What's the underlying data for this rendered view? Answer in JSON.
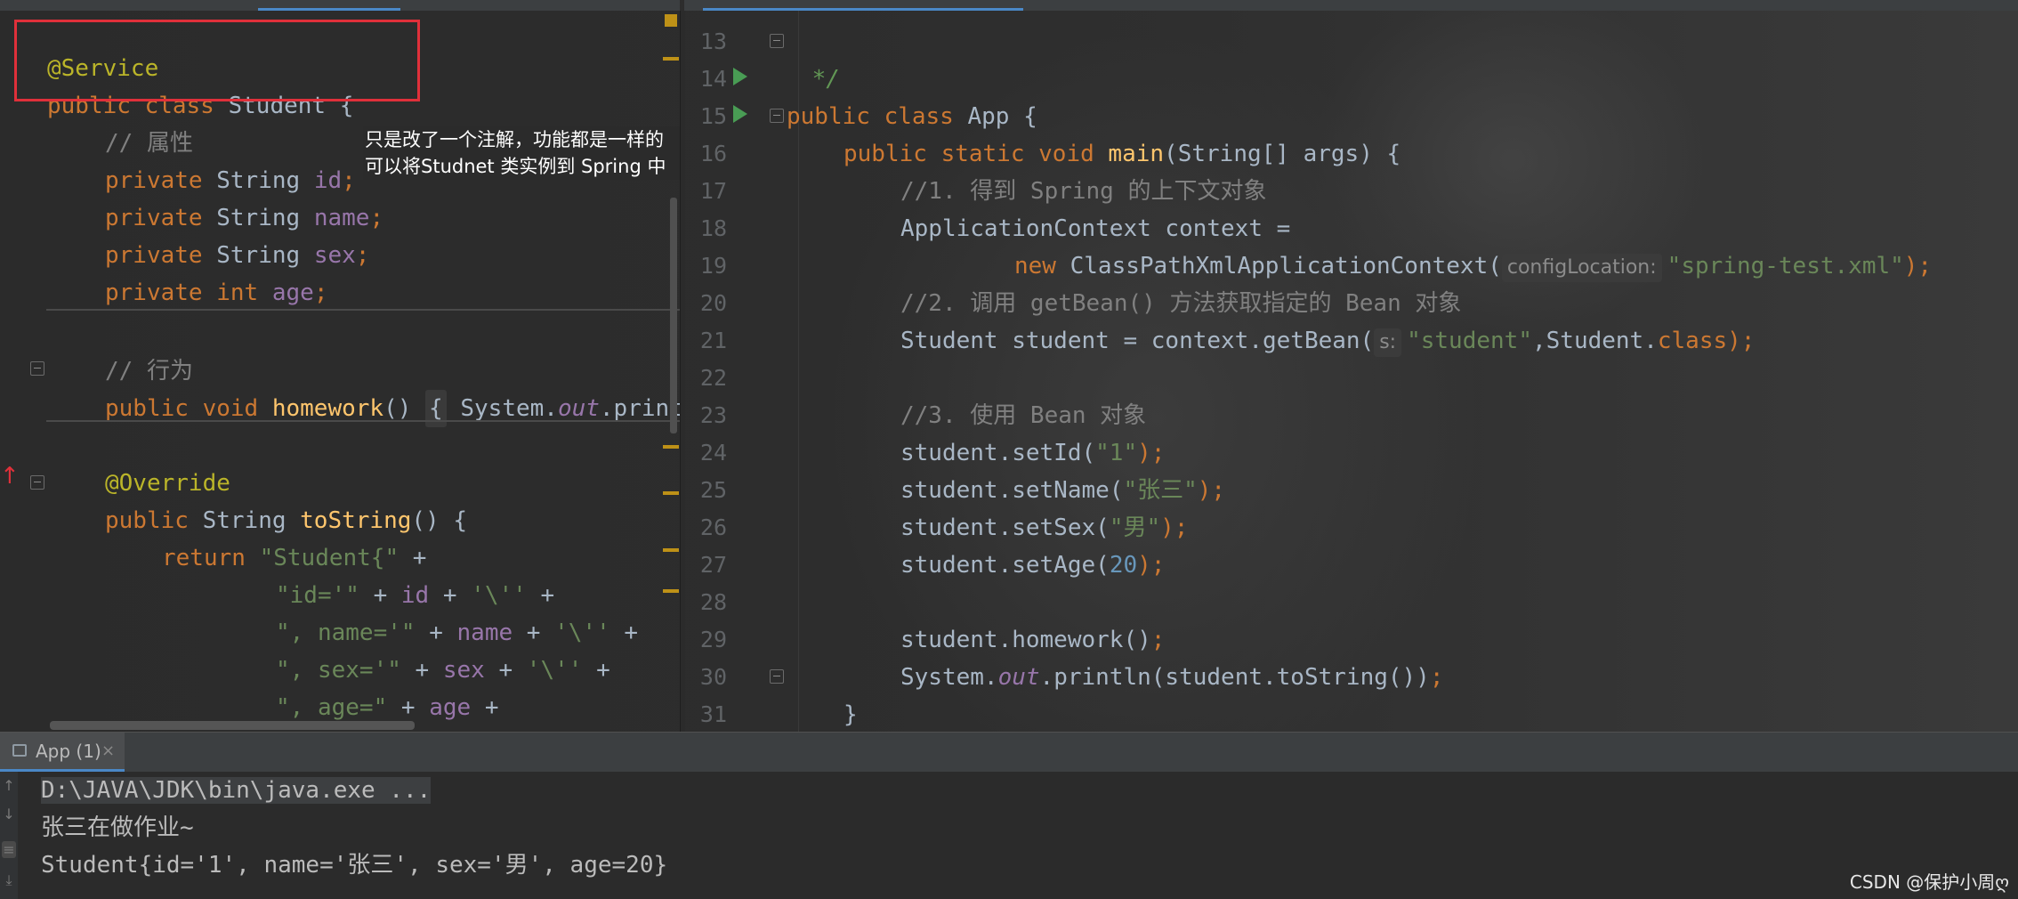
{
  "left_editor": {
    "annotation_service": "@Service",
    "class_decl_kw": "public class",
    "class_name": "Student",
    "class_brace": " {",
    "comment_props": "// 属性",
    "fields": [
      {
        "mod": "private",
        "type": "String",
        "name": "id"
      },
      {
        "mod": "private",
        "type": "String",
        "name": "name"
      },
      {
        "mod": "private",
        "type": "String",
        "name": "sex"
      },
      {
        "mod": "private",
        "type": "int",
        "name": "age"
      }
    ],
    "comment_behavior": "// 行为",
    "homework_kw": "public void",
    "homework_name": "homework",
    "homework_parens": "() ",
    "homework_fold": "{",
    "homework_body_a": " System.",
    "homework_body_out": "out",
    "homework_body_b": ".print",
    "override": "@Override",
    "tostring_kw": "public",
    "tostring_type": " String ",
    "tostring_name": "toString",
    "tostring_rest": "() {",
    "return_kw": "return",
    "return_str": "\"Student{\"",
    "plus": " +",
    "concat_lines": [
      {
        "s1": "\"id='\"",
        "f": "id",
        "s2": "'\\''"
      },
      {
        "s1": "\", name='\"",
        "f": "name",
        "s2": "'\\''"
      },
      {
        "s1": "\", sex='\"",
        "f": "sex",
        "s2": "'\\''"
      },
      {
        "s1": "\", age=\"",
        "f": "age",
        "s2": ""
      }
    ],
    "last_line_str": "'}'",
    "callout_line1": "只是改了一个注解，功能都是一样的",
    "callout_line2": "可以将Studnet 类实例到 Spring 中"
  },
  "right_editor": {
    "line_numbers": [
      "13",
      "14",
      "15",
      "16",
      "17",
      "18",
      "19",
      "20",
      "21",
      "22",
      "23",
      "24",
      "25",
      "26",
      "27",
      "28",
      "29",
      "30",
      "31"
    ],
    "javadoc_end": " */",
    "class_kw": "public class",
    "class_name": "App",
    "class_brace": " {",
    "main_kw": "public static void",
    "main_name": "main",
    "main_params": "(String[] args) {",
    "comment1": "//1. 得到 Spring 的上下文对象",
    "ctx_decl": "ApplicationContext context =",
    "new_kw": "new",
    "ctx_class": " ClassPathXmlApplicationContext(",
    "hint_config": "configLocation:",
    "xml_str": "\"spring-test.xml\"",
    "close_paren_semi": ");",
    "comment2": "//2. 调用 getBean() 方法获取指定的 Bean 对象",
    "getbean_a": "Student student = context.getBean(",
    "hint_s": "s:",
    "getbean_str": "\"student\"",
    "getbean_b": ",Student.",
    "class_kw2": "class",
    "comment3": "//3. 使用 Bean 对象",
    "set_id": "student.setId(",
    "set_id_val": "\"1\"",
    "set_name": "student.setName(",
    "set_name_val": "\"张三\"",
    "set_sex": "student.setSex(",
    "set_sex_val": "\"男\"",
    "set_age": "student.setAge(",
    "set_age_val": "20",
    "homework_call": "student.homework()",
    "semi": ";",
    "println_a": "System.",
    "println_out": "out",
    "println_b": ".println(student.toString())",
    "close_brace": "}"
  },
  "run_panel": {
    "tab_label": "App (1)",
    "tab_close": "×",
    "console_lines": [
      "D:\\JAVA\\JDK\\bin\\java.exe ...",
      "张三在做作业~",
      "Student{id='1', name='张三', sex='男', age=20}"
    ]
  },
  "watermark": "CSDN @保护小周ღ",
  "colors": {
    "keyword": "#cc7832",
    "annotation": "#bbb529",
    "string": "#6a8759",
    "field": "#9876aa",
    "method": "#ffc66d",
    "comment": "#808080",
    "number": "#6897bb",
    "highlight_box": "#e0303a"
  }
}
